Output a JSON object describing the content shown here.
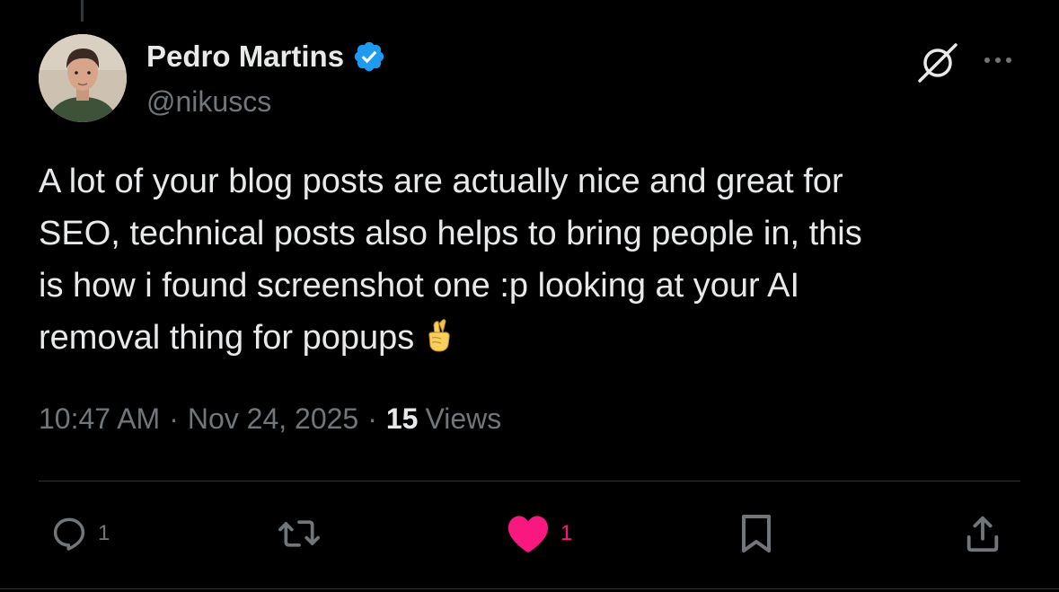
{
  "tweet": {
    "author": {
      "display_name": "Pedro Martins",
      "handle": "@nikuscs",
      "verified": true
    },
    "text": "A lot of your blog posts are actually nice and great for\nSEO, technical posts also helps to bring people in, this\nis how i found screenshot one :p looking at your AI\nremoval thing for popups",
    "emoji": "crossed-fingers-emoji",
    "time": "10:47 AM",
    "date": "Nov 24, 2025",
    "separator": "·",
    "views_count": "15",
    "views_label": "Views"
  },
  "actions": {
    "reply_count": "1",
    "retweet_count": "",
    "like_count": "1",
    "like_active": true
  },
  "icons": {
    "verified": "verified-badge-icon",
    "grok": "grok-icon",
    "more": "more-options-icon",
    "reply": "reply-icon",
    "retweet": "retweet-icon",
    "like": "heart-icon",
    "bookmark": "bookmark-icon",
    "share": "share-icon"
  },
  "colors": {
    "background": "#000000",
    "primary_text": "#e7e9ea",
    "secondary_text": "#71767b",
    "verified_blue": "#1d9bf0",
    "like_pink": "#f91880",
    "divider": "#2f3336"
  }
}
